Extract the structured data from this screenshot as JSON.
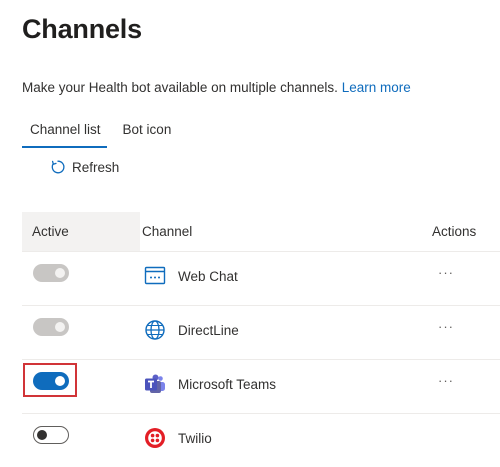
{
  "page": {
    "title": "Channels",
    "description": "Make your Health bot available on multiple channels.",
    "learn_more": "Learn more"
  },
  "tabs": [
    {
      "label": "Channel list",
      "active": true
    },
    {
      "label": "Bot icon",
      "active": false
    }
  ],
  "toolbar": {
    "refresh_label": "Refresh",
    "refresh_icon": "refresh-icon"
  },
  "table": {
    "headers": {
      "active": "Active",
      "channel": "Channel",
      "actions": "Actions"
    },
    "rows": [
      {
        "channel": "Web Chat",
        "icon": "web-chat-icon",
        "toggle": "on-disabled",
        "actions": "···"
      },
      {
        "channel": "DirectLine",
        "icon": "globe-icon",
        "toggle": "on-disabled",
        "actions": "···"
      },
      {
        "channel": "Microsoft Teams",
        "icon": "teams-icon",
        "toggle": "on",
        "highlighted": true,
        "actions": "···"
      },
      {
        "channel": "Twilio",
        "icon": "twilio-icon",
        "toggle": "off",
        "actions": ""
      }
    ]
  },
  "colors": {
    "accent": "#0f6cbd",
    "highlight_border": "#d13438",
    "teams_purple": "#5b5fc7",
    "twilio_red": "#e31e26"
  }
}
